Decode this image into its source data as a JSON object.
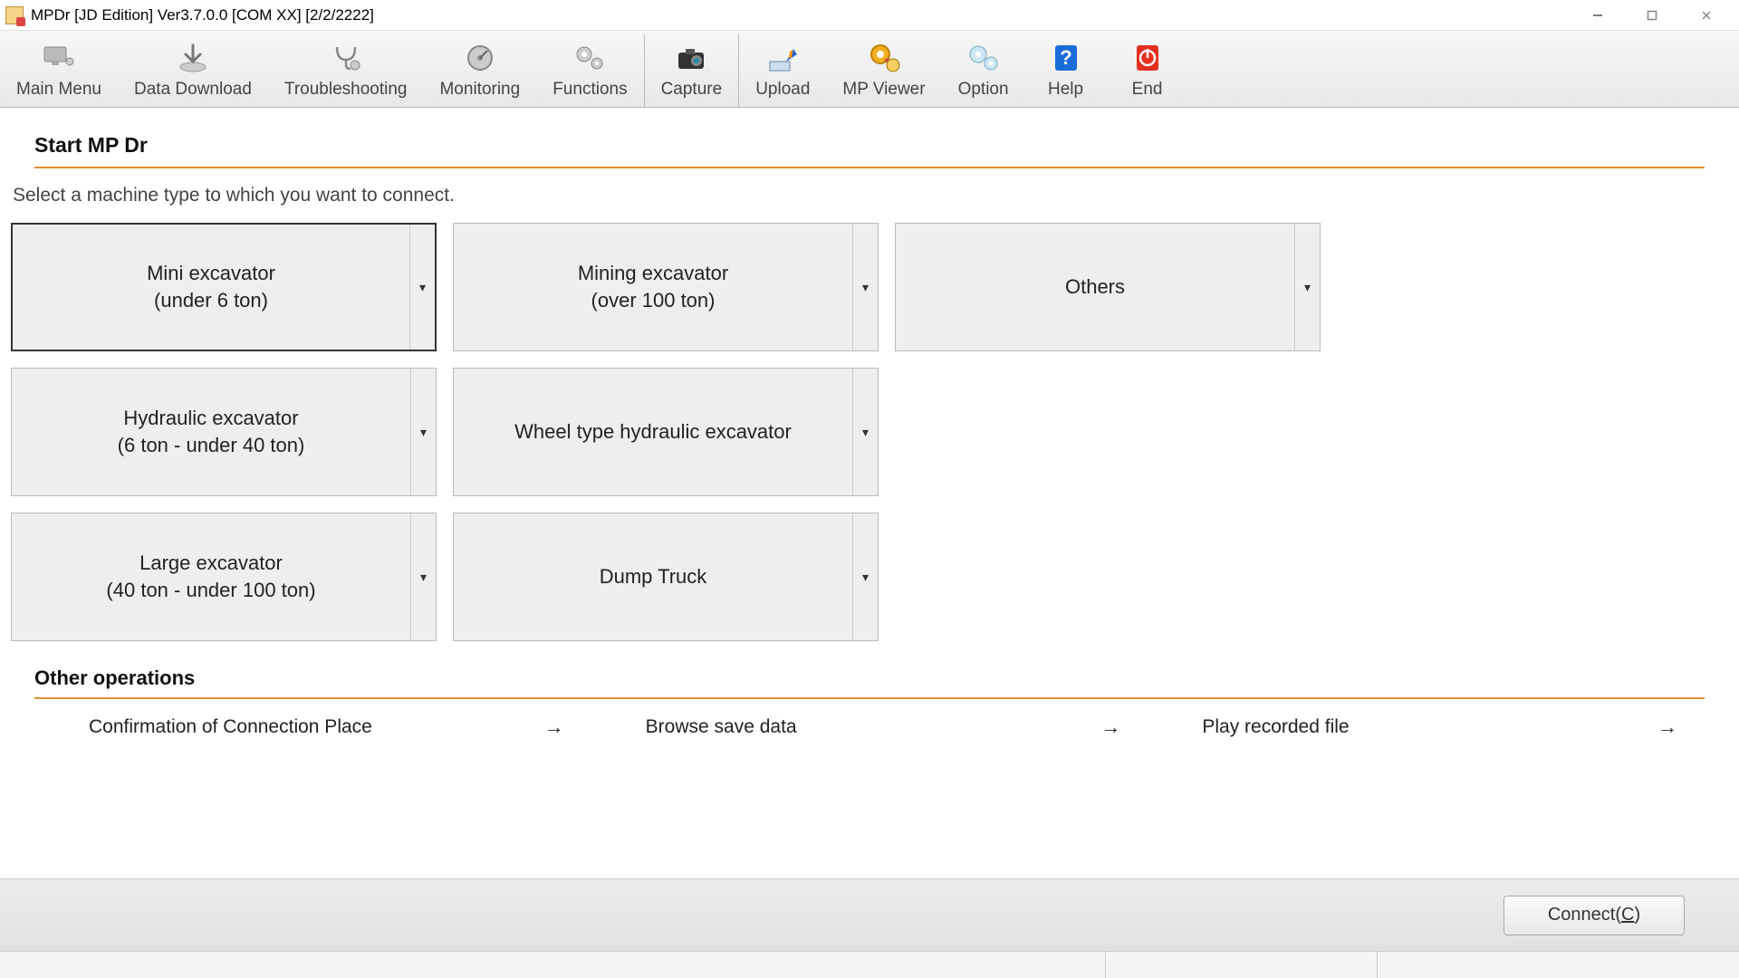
{
  "window": {
    "title": "MPDr [JD Edition] Ver3.7.0.0 [COM XX] [2/2/2222]"
  },
  "toolbar": {
    "main_menu": "Main Menu",
    "data_download": "Data Download",
    "troubleshooting": "Troubleshooting",
    "monitoring": "Monitoring",
    "functions": "Functions",
    "capture": "Capture",
    "upload": "Upload",
    "mp_viewer": "MP Viewer",
    "option": "Option",
    "help": "Help",
    "end": "End"
  },
  "main": {
    "heading": "Start MP Dr",
    "prompt": "Select a machine type to which you want to connect.",
    "machines": {
      "mini_excavator_l1": "Mini excavator",
      "mini_excavator_l2": "(under 6 ton)",
      "mining_excavator_l1": "Mining excavator",
      "mining_excavator_l2": "(over 100 ton)",
      "others": "Others",
      "hydraulic_l1": "Hydraulic excavator",
      "hydraulic_l2": "(6 ton - under 40 ton)",
      "wheel_hydraulic": "Wheel type hydraulic excavator",
      "large_l1": "Large excavator",
      "large_l2": "(40 ton - under 100 ton)",
      "dump_truck": "Dump Truck"
    },
    "other_ops_heading": "Other operations",
    "ops": {
      "confirm_conn": "Confirmation of Connection Place",
      "browse_save": "Browse save data",
      "play_recorded": "Play recorded file"
    }
  },
  "footer": {
    "connect_prefix": "Connect(",
    "connect_key": "C",
    "connect_suffix": ")"
  }
}
